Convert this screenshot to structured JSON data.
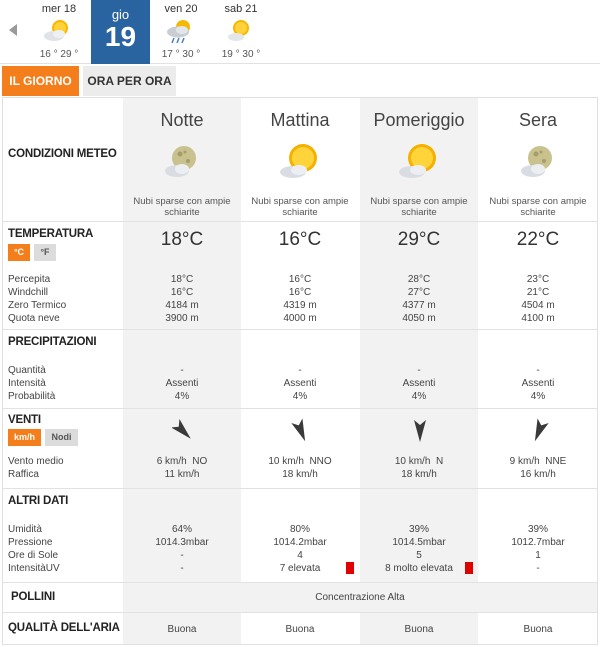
{
  "days": [
    {
      "name": "mer 18",
      "temps": "16 ° 29 °",
      "icon": "sun-cloud-icon"
    },
    {
      "name": "gio",
      "number": "19",
      "active": true
    },
    {
      "name": "ven 20",
      "temps": "17 ° 30 °",
      "icon": "sun-cloud-rain-icon"
    },
    {
      "name": "sab 21",
      "temps": "19 ° 30 °",
      "icon": "sun-cloud-icon"
    }
  ],
  "tabs": {
    "day": "IL GIORNO",
    "hourly": "ORA PER ORA"
  },
  "sections": {
    "conditions": "CONDIZIONI METEO",
    "temperature": "TEMPERATURA",
    "precipitation": "PRECIPITAZIONI",
    "winds": "VENTI",
    "other": "ALTRI DATI",
    "pollen": "POLLINI",
    "air_quality": "QUALITÀ DELL'ARIA"
  },
  "units": {
    "celsius": "°C",
    "fahrenheit": "°F",
    "kmh": "km/h",
    "knots": "Nodi"
  },
  "labels": {
    "perceived": "Percepita",
    "windchill": "Windchill",
    "freezing_level": "Zero Termico",
    "snow_level": "Quota neve",
    "quantity": "Quantità",
    "intensity": "Intensità",
    "probability": "Probabilità",
    "avg_wind": "Vento medio",
    "gust": "Raffica",
    "humidity": "Umidità",
    "pressure": "Pressione",
    "sun_hours": "Ore di Sole",
    "uv": "IntensitàUV"
  },
  "periods": [
    {
      "name": "Notte",
      "icon": "moon-cloud-icon",
      "desc": [
        "Nubi sparse con ampie",
        "schiarite"
      ],
      "temp": "18°C",
      "perceived": "18°C",
      "windchill": "16°C",
      "freezing": "4184 m",
      "snow": "3900 m",
      "quantity": "-",
      "intensity": "Assenti",
      "probability": "4%",
      "wind_dir_deg": 315,
      "wind_avg": "6 km/h  NO",
      "gust": "11 km/h",
      "humidity": "64%",
      "pressure": "1014.3mbar",
      "sun_hours": "-",
      "uv": "-",
      "uv_alert": false,
      "air": "Buona"
    },
    {
      "name": "Mattina",
      "icon": "sun-cloud-icon",
      "desc": [
        "Nubi sparse con ampie",
        "schiarite"
      ],
      "temp": "16°C",
      "perceived": "16°C",
      "windchill": "16°C",
      "freezing": "4319 m",
      "snow": "4000 m",
      "quantity": "-",
      "intensity": "Assenti",
      "probability": "4%",
      "wind_dir_deg": 338,
      "wind_avg": "10 km/h  NNO",
      "gust": "18 km/h",
      "humidity": "80%",
      "pressure": "1014.2mbar",
      "sun_hours": "4",
      "uv": "7 elevata",
      "uv_alert": true,
      "air": "Buona"
    },
    {
      "name": "Pomeriggio",
      "icon": "sun-cloud-icon",
      "desc": [
        "Nubi sparse con ampie",
        "schiarite"
      ],
      "temp": "29°C",
      "perceived": "28°C",
      "windchill": "27°C",
      "freezing": "4377 m",
      "snow": "4050 m",
      "quantity": "-",
      "intensity": "Assenti",
      "probability": "4%",
      "wind_dir_deg": 0,
      "wind_avg": "10 km/h  N",
      "gust": "18 km/h",
      "humidity": "39%",
      "pressure": "1014.5mbar",
      "sun_hours": "5",
      "uv": "8 molto elevata",
      "uv_alert": true,
      "air": "Buona"
    },
    {
      "name": "Sera",
      "icon": "moon-cloud-icon",
      "desc": [
        "Nubi sparse con ampie",
        "schiarite"
      ],
      "temp": "22°C",
      "perceived": "23°C",
      "windchill": "21°C",
      "freezing": "4504 m",
      "snow": "4100 m",
      "quantity": "-",
      "intensity": "Assenti",
      "probability": "4%",
      "wind_dir_deg": 22,
      "wind_avg": "9 km/h  NNE",
      "gust": "16 km/h",
      "humidity": "39%",
      "pressure": "1012.7mbar",
      "sun_hours": "1",
      "uv": "-",
      "uv_alert": false,
      "air": "Buona"
    }
  ],
  "pollen_value": "Concentrazione Alta",
  "colors": {
    "accent": "#f47e1b",
    "active_day": "#2a64a0",
    "uv_alert": "#e00000",
    "alt_col": "#f2f2f2"
  }
}
